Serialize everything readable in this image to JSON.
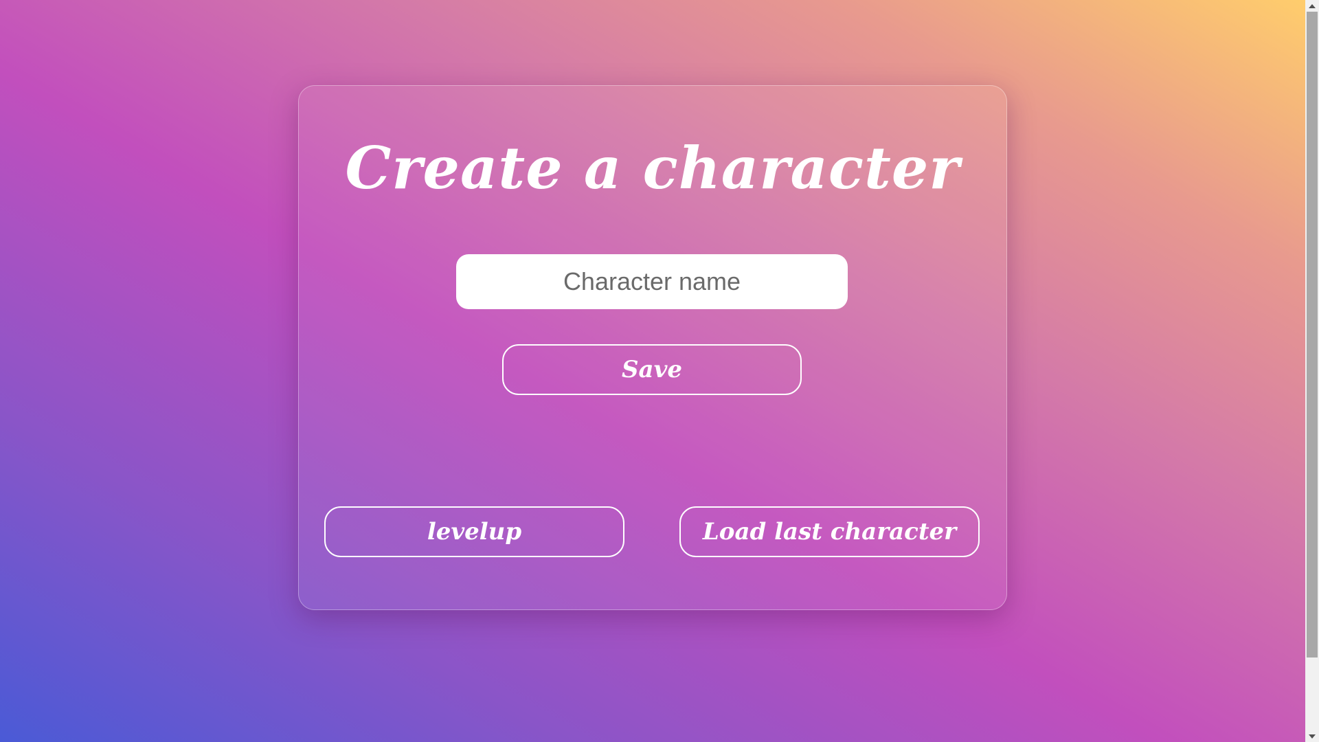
{
  "page": {
    "title": "Create a character"
  },
  "form": {
    "name_placeholder": "Character name",
    "name_value": "",
    "save_label": "Save"
  },
  "actions": {
    "levelup_label": "levelup",
    "load_last_label": "Load last character"
  },
  "colors": {
    "gradient_start": "#4a5ad6",
    "gradient_mid": "#c24fbd",
    "gradient_end": "#ffcd6c",
    "text": "#ffffff"
  },
  "icons": {
    "scroll_up": "scroll-up-arrow-icon",
    "scroll_down": "scroll-down-arrow-icon"
  }
}
